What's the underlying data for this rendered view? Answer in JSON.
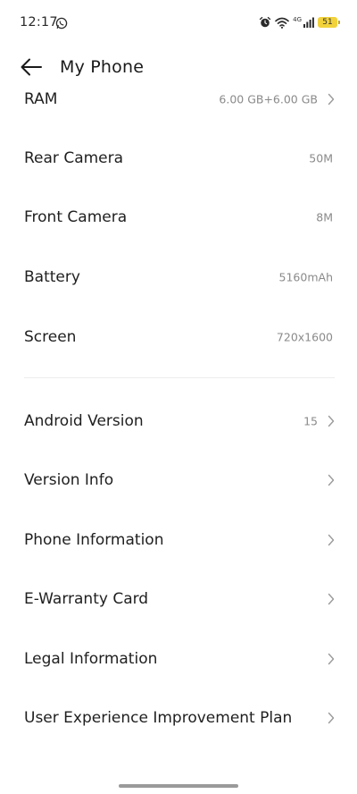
{
  "status_bar": {
    "time": "12:17",
    "battery_level": "51",
    "network": "4G",
    "icons": [
      "whatsapp-icon",
      "alarm-icon",
      "wifi-icon",
      "signal-icon",
      "battery-icon"
    ]
  },
  "header": {
    "title": "My Phone",
    "back_icon": "arrow-left-icon"
  },
  "specs": [
    {
      "label": "RAM",
      "value": "6.00 GB+6.00 GB",
      "chevron": true
    },
    {
      "label": "Rear Camera",
      "value": "50M",
      "chevron": false
    },
    {
      "label": "Front Camera",
      "value": "8M",
      "chevron": false
    },
    {
      "label": "Battery",
      "value": "5160mAh",
      "chevron": false
    },
    {
      "label": "Screen",
      "value": "720x1600",
      "chevron": false
    }
  ],
  "info": [
    {
      "label": "Android Version",
      "value": "15",
      "chevron": true
    },
    {
      "label": "Version Info",
      "value": "",
      "chevron": true
    },
    {
      "label": "Phone Information",
      "value": "",
      "chevron": true
    },
    {
      "label": "E-Warranty Card",
      "value": "",
      "chevron": true
    },
    {
      "label": "Legal Information",
      "value": "",
      "chevron": true
    },
    {
      "label": "User Experience Improvement Plan",
      "value": "",
      "chevron": true
    }
  ],
  "colors": {
    "text_primary": "#1f1f1f",
    "text_secondary": "#8a8a8a",
    "battery_badge": "#f2d23c",
    "background": "#ffffff"
  }
}
